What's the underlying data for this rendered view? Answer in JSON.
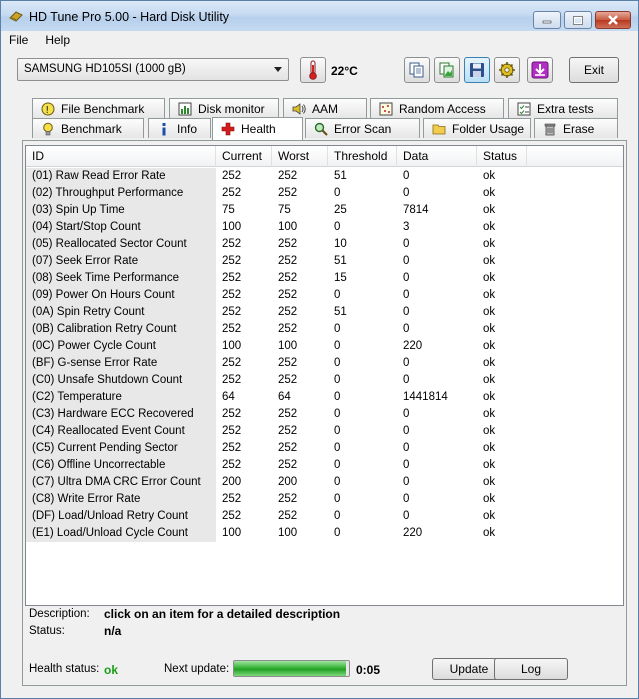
{
  "window": {
    "title": "HD Tune Pro 5.00 - Hard Disk Utility"
  },
  "menu": {
    "file": "File",
    "help": "Help"
  },
  "toolbar": {
    "drive": "SAMSUNG HD105SI (1000 gB)",
    "temperature": "22°C",
    "exit_label": "Exit",
    "icons": [
      "copy-text-icon",
      "copy-screenshot-icon",
      "save-icon",
      "settings-icon",
      "download-icon"
    ]
  },
  "tabs_row1": [
    "File Benchmark",
    "Disk monitor",
    "AAM",
    "Random Access",
    "Extra tests"
  ],
  "tabs_row2": [
    "Benchmark",
    "Info",
    "Health",
    "Error Scan",
    "Folder Usage",
    "Erase"
  ],
  "selected_tab": "Health",
  "table": {
    "columns": [
      "ID",
      "Current",
      "Worst",
      "Threshold",
      "Data",
      "Status"
    ],
    "rows": [
      [
        "(01) Raw Read Error Rate",
        "252",
        "252",
        "51",
        "0",
        "ok"
      ],
      [
        "(02) Throughput Performance",
        "252",
        "252",
        "0",
        "0",
        "ok"
      ],
      [
        "(03) Spin Up Time",
        "75",
        "75",
        "25",
        "7814",
        "ok"
      ],
      [
        "(04) Start/Stop Count",
        "100",
        "100",
        "0",
        "3",
        "ok"
      ],
      [
        "(05) Reallocated Sector Count",
        "252",
        "252",
        "10",
        "0",
        "ok"
      ],
      [
        "(07) Seek Error Rate",
        "252",
        "252",
        "51",
        "0",
        "ok"
      ],
      [
        "(08) Seek Time Performance",
        "252",
        "252",
        "15",
        "0",
        "ok"
      ],
      [
        "(09) Power On Hours Count",
        "252",
        "252",
        "0",
        "0",
        "ok"
      ],
      [
        "(0A) Spin Retry Count",
        "252",
        "252",
        "51",
        "0",
        "ok"
      ],
      [
        "(0B) Calibration Retry Count",
        "252",
        "252",
        "0",
        "0",
        "ok"
      ],
      [
        "(0C) Power Cycle Count",
        "100",
        "100",
        "0",
        "220",
        "ok"
      ],
      [
        "(BF) G-sense Error Rate",
        "252",
        "252",
        "0",
        "0",
        "ok"
      ],
      [
        "(C0) Unsafe Shutdown Count",
        "252",
        "252",
        "0",
        "0",
        "ok"
      ],
      [
        "(C2) Temperature",
        "64",
        "64",
        "0",
        "1441814",
        "ok"
      ],
      [
        "(C3) Hardware ECC Recovered",
        "252",
        "252",
        "0",
        "0",
        "ok"
      ],
      [
        "(C4) Reallocated Event Count",
        "252",
        "252",
        "0",
        "0",
        "ok"
      ],
      [
        "(C5) Current Pending Sector",
        "252",
        "252",
        "0",
        "0",
        "ok"
      ],
      [
        "(C6) Offline Uncorrectable",
        "252",
        "252",
        "0",
        "0",
        "ok"
      ],
      [
        "(C7) Ultra DMA CRC Error Count",
        "200",
        "200",
        "0",
        "0",
        "ok"
      ],
      [
        "(C8) Write Error Rate",
        "252",
        "252",
        "0",
        "0",
        "ok"
      ],
      [
        "(DF) Load/Unload Retry Count",
        "252",
        "252",
        "0",
        "0",
        "ok"
      ],
      [
        "(E1) Load/Unload Cycle Count",
        "100",
        "100",
        "0",
        "220",
        "ok"
      ]
    ]
  },
  "description": {
    "label": "Description:",
    "value": "click on an item for a detailed description"
  },
  "status": {
    "label": "Status:",
    "value": "n/a"
  },
  "health": {
    "label": "Health status:",
    "value": "ok",
    "color": "#1a9e1a"
  },
  "next_update": {
    "label": "Next update:",
    "progress": 0.97,
    "countdown": "0:05"
  },
  "buttons": {
    "update": "Update",
    "log": "Log"
  }
}
